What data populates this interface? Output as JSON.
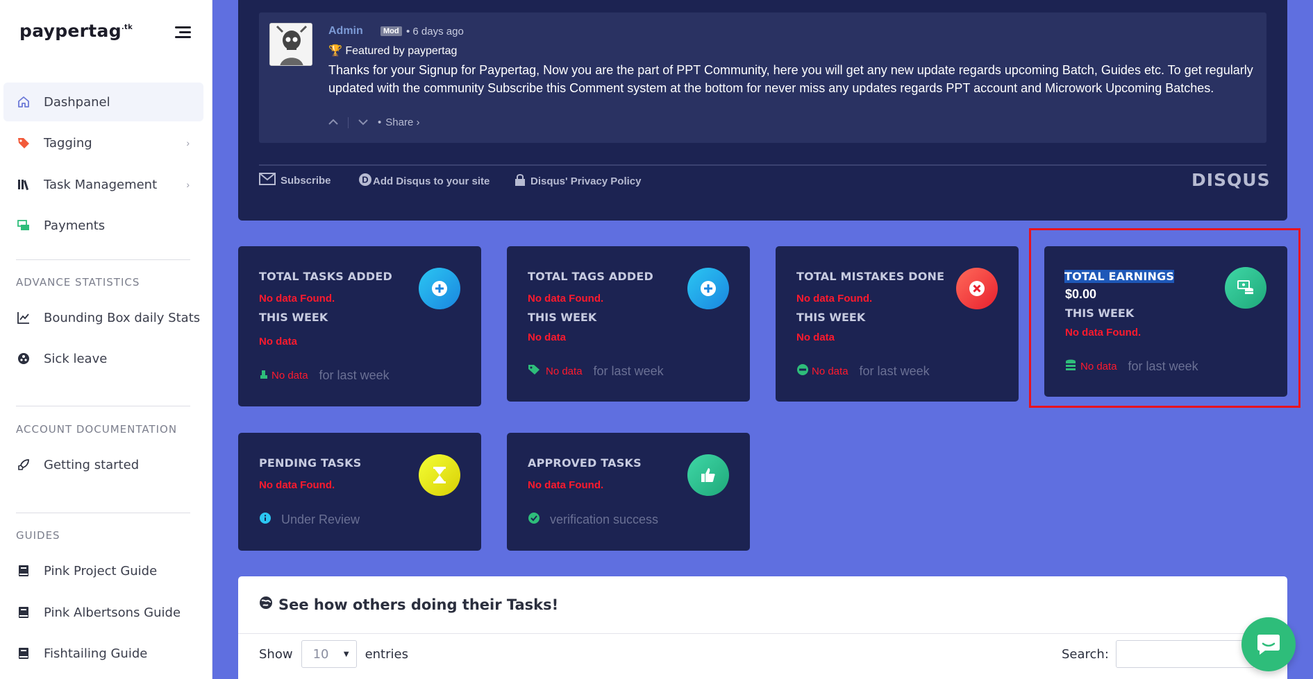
{
  "brand": {
    "name": "paypertag",
    "tld": ".tk"
  },
  "sidebar": {
    "items": [
      {
        "label": "Dashpanel",
        "icon": "home-icon"
      },
      {
        "label": "Tagging",
        "icon": "tag-icon"
      },
      {
        "label": "Task Management",
        "icon": "library-icon"
      },
      {
        "label": "Payments",
        "icon": "money-icon"
      }
    ],
    "sections": [
      {
        "title": "ADVANCE STATISTICS",
        "items": [
          {
            "label": "Bounding Box daily Stats",
            "icon": "chart-line-icon"
          },
          {
            "label": "Sick leave",
            "icon": "virus-icon"
          }
        ]
      },
      {
        "title": "ACCOUNT DOCUMENTATION",
        "items": [
          {
            "label": "Getting started",
            "icon": "rocket-icon"
          }
        ]
      },
      {
        "title": "GUIDES",
        "items": [
          {
            "label": "Pink Project Guide",
            "icon": "book-icon"
          },
          {
            "label": "Pink Albertsons Guide",
            "icon": "book-icon"
          },
          {
            "label": "Fishtailing Guide",
            "icon": "book-icon"
          }
        ]
      }
    ]
  },
  "comment": {
    "author": "Admin",
    "badge": "Mod",
    "time": "• 6 days ago",
    "featured": "Featured by paypertag",
    "text": "Thanks for your Signup for Paypertag, Now you are the part of PPT Community, here you will get any new update regards upcoming Batch, Guides etc. To get regularly updated with the community Subscribe this Comment system at the bottom for never miss any updates regards PPT account and Microwork Upcoming Batches.",
    "share": "Share ›",
    "bullet": "•"
  },
  "disqus_footer": {
    "subscribe": "Subscribe",
    "add": "Add Disqus to your site",
    "privacy": "Disqus' Privacy Policy",
    "logo": "DISQUS"
  },
  "cards": {
    "tasks_added": {
      "title": "TOTAL TASKS ADDED",
      "status": "No data Found.",
      "week": "THIS WEEK",
      "week_value": "No data",
      "foot_value": "No data",
      "foot_label": "for last week"
    },
    "tags_added": {
      "title": "TOTAL TAGS ADDED",
      "status": "No data Found.",
      "week": "THIS WEEK",
      "week_value": "No data",
      "foot_value": "No data",
      "foot_label": "for last week"
    },
    "mistakes": {
      "title": "TOTAL MISTAKES DONE",
      "status": "No data Found.",
      "week": "THIS WEEK",
      "week_value": "No data",
      "foot_value": "No data",
      "foot_label": "for last week"
    },
    "earnings": {
      "title": "TOTAL EARNINGS",
      "value": "$0.00",
      "week": "THIS WEEK",
      "week_value": "No data Found.",
      "foot_value": "No data",
      "foot_label": "for last week"
    },
    "pending": {
      "title": "PENDING TASKS",
      "status": "No data Found.",
      "foot_label": "Under Review"
    },
    "approved": {
      "title": "APPROVED TASKS",
      "status": "No data Found.",
      "foot_label": "verification success"
    }
  },
  "colors": {
    "accent": "#5f6fe0",
    "card_bg": "#1c2352",
    "error": "#ff1a2d",
    "success": "#2ebd7a"
  },
  "table": {
    "title": "See how others doing their Tasks!",
    "show_label": "Show",
    "page_size": "10",
    "entries_label": "entries",
    "search_label": "Search:"
  }
}
